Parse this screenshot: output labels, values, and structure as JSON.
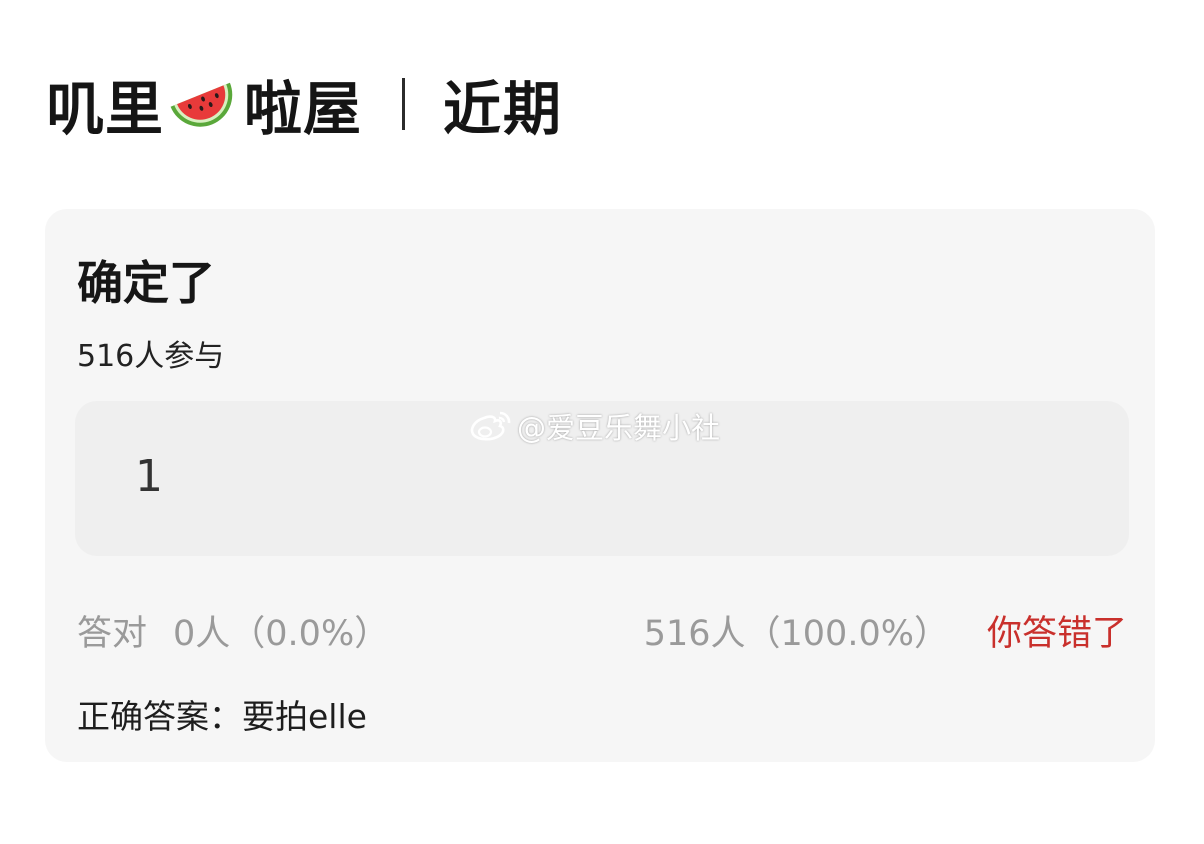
{
  "header": {
    "brand_left": "叽里",
    "brand_icon": "watermelon-icon",
    "brand_right": "啦屋",
    "section": "近期"
  },
  "quiz": {
    "question": "确定了",
    "participants": "516人参与",
    "option": "1",
    "correct_label": "答对",
    "correct_value": "0人（0.0%）",
    "chosen_value": "516人（100.0%）",
    "verdict": "你答错了",
    "answer_label": "正确答案：",
    "answer_value": "要拍elle",
    "verdict_color": "#c9302c"
  },
  "watermark": {
    "icon": "weibo-icon",
    "text": "@爱豆乐舞小社"
  }
}
